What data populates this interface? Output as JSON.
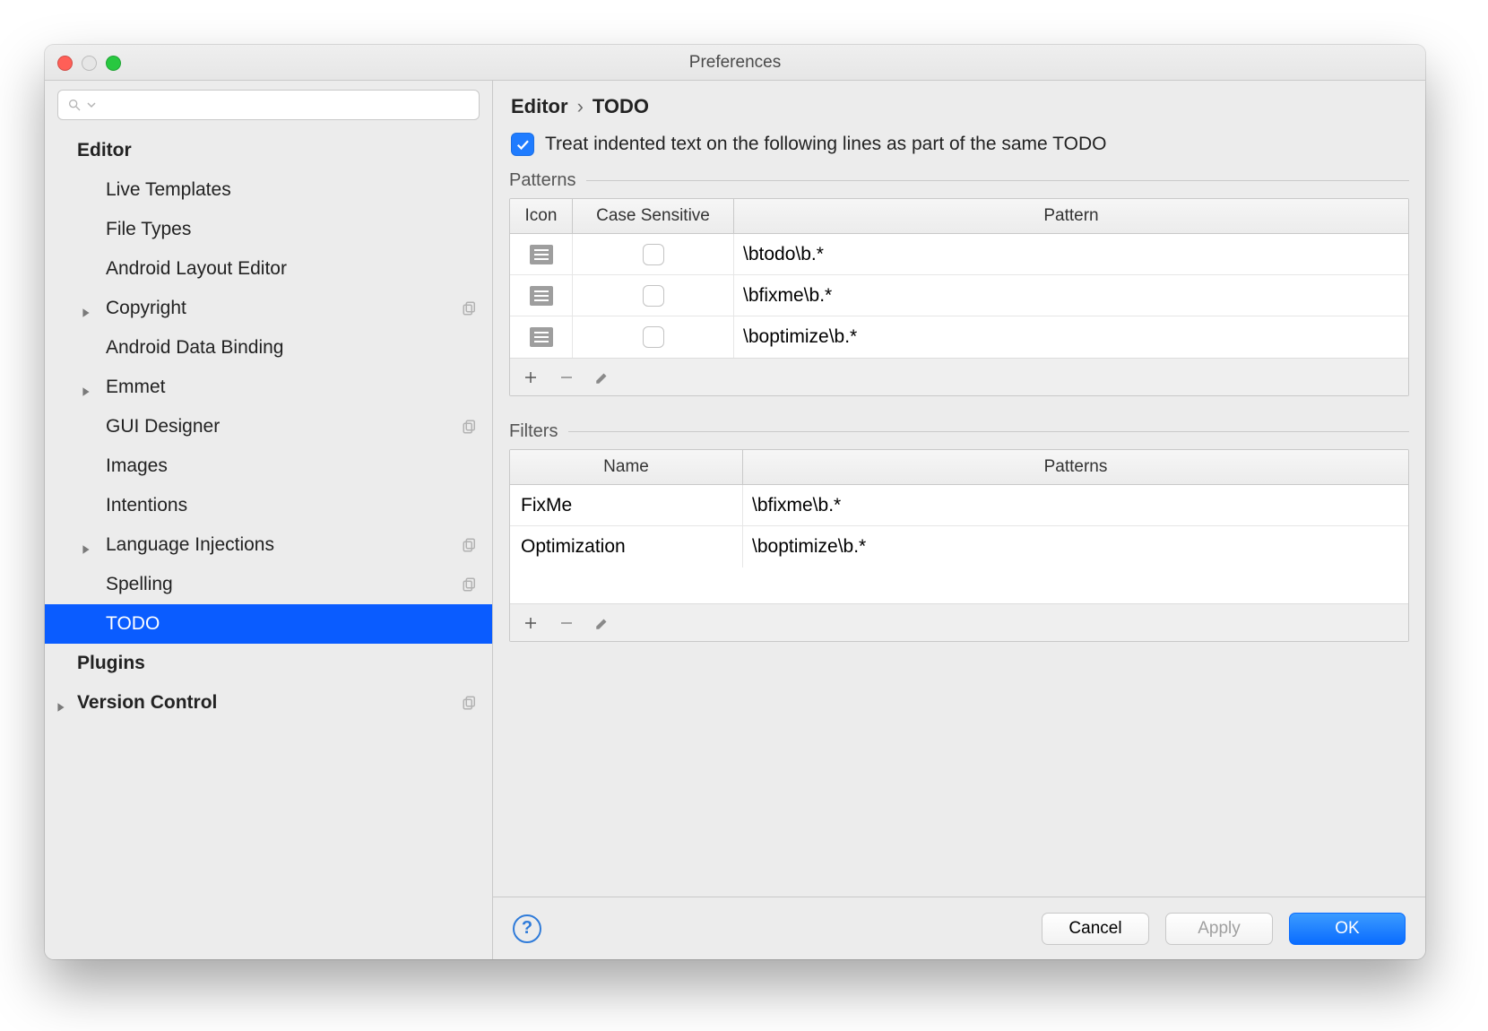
{
  "window": {
    "title": "Preferences"
  },
  "search": {
    "placeholder": ""
  },
  "sidebar": {
    "items": [
      {
        "label": "Editor",
        "level": 0,
        "bold": true,
        "arrow": false,
        "copy": false,
        "selected": false
      },
      {
        "label": "Live Templates",
        "level": 1,
        "bold": false,
        "arrow": false,
        "copy": false,
        "selected": false
      },
      {
        "label": "File Types",
        "level": 1,
        "bold": false,
        "arrow": false,
        "copy": false,
        "selected": false
      },
      {
        "label": "Android Layout Editor",
        "level": 1,
        "bold": false,
        "arrow": false,
        "copy": false,
        "selected": false
      },
      {
        "label": "Copyright",
        "level": 1,
        "bold": false,
        "arrow": true,
        "copy": true,
        "selected": false
      },
      {
        "label": "Android Data Binding",
        "level": 1,
        "bold": false,
        "arrow": false,
        "copy": false,
        "selected": false
      },
      {
        "label": "Emmet",
        "level": 1,
        "bold": false,
        "arrow": true,
        "copy": false,
        "selected": false
      },
      {
        "label": "GUI Designer",
        "level": 1,
        "bold": false,
        "arrow": false,
        "copy": true,
        "selected": false
      },
      {
        "label": "Images",
        "level": 1,
        "bold": false,
        "arrow": false,
        "copy": false,
        "selected": false
      },
      {
        "label": "Intentions",
        "level": 1,
        "bold": false,
        "arrow": false,
        "copy": false,
        "selected": false
      },
      {
        "label": "Language Injections",
        "level": 1,
        "bold": false,
        "arrow": true,
        "copy": true,
        "selected": false
      },
      {
        "label": "Spelling",
        "level": 1,
        "bold": false,
        "arrow": false,
        "copy": true,
        "selected": false
      },
      {
        "label": "TODO",
        "level": 1,
        "bold": false,
        "arrow": false,
        "copy": false,
        "selected": true
      },
      {
        "label": "Plugins",
        "level": 0,
        "bold": true,
        "arrow": false,
        "copy": false,
        "selected": false,
        "extraIndent": true
      },
      {
        "label": "Version Control",
        "level": 0,
        "bold": true,
        "arrow": true,
        "copy": true,
        "selected": false
      }
    ]
  },
  "breadcrumb": {
    "a": "Editor",
    "sep": "›",
    "b": "TODO"
  },
  "options": {
    "treatIndented": {
      "checked": true,
      "label": "Treat indented text on the following lines as part of the same TODO"
    }
  },
  "patterns": {
    "title": "Patterns",
    "columns": {
      "icon": "Icon",
      "case": "Case Sensitive",
      "pattern": "Pattern"
    },
    "rows": [
      {
        "caseSensitive": false,
        "pattern": "\\btodo\\b.*"
      },
      {
        "caseSensitive": false,
        "pattern": "\\bfixme\\b.*"
      },
      {
        "caseSensitive": false,
        "pattern": "\\boptimize\\b.*"
      }
    ]
  },
  "filters": {
    "title": "Filters",
    "columns": {
      "name": "Name",
      "patterns": "Patterns"
    },
    "rows": [
      {
        "name": "FixMe",
        "patterns": "\\bfixme\\b.*"
      },
      {
        "name": "Optimization",
        "patterns": "\\boptimize\\b.*"
      }
    ]
  },
  "footer": {
    "cancel": "Cancel",
    "apply": "Apply",
    "ok": "OK"
  }
}
